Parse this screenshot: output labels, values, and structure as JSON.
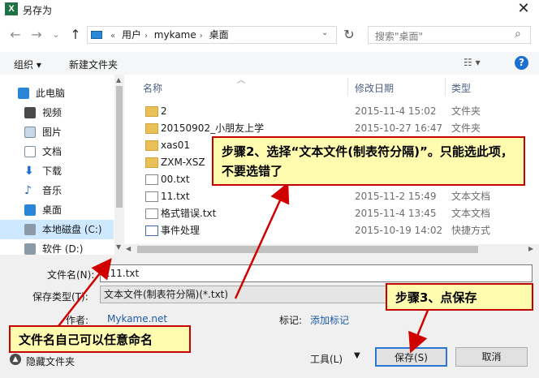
{
  "window": {
    "app_icon": "X",
    "title": "另存为",
    "close": "✕"
  },
  "nav": {
    "back": "←",
    "forward": "→",
    "recent": "⌄",
    "up": "↑",
    "refresh": "↻"
  },
  "address": {
    "overflow": "«",
    "crumbs": [
      "用户",
      "mykame",
      "桌面"
    ]
  },
  "search": {
    "placeholder": "搜索\"桌面\""
  },
  "toolbar": {
    "organize": "组织 ▾",
    "new_folder": "新建文件夹",
    "view": "☷ ▾",
    "help": "?"
  },
  "sidebar": {
    "items": [
      "此电脑",
      "视频",
      "图片",
      "文档",
      "下载",
      "音乐",
      "桌面",
      "本地磁盘 (C:)",
      "软件 (D:)"
    ]
  },
  "columns": {
    "name": "名称",
    "date": "修改日期",
    "type": "类型"
  },
  "files": [
    {
      "name": "2",
      "date": "2015-11-4 15:02",
      "type": "文件夹"
    },
    {
      "name": "20150902_小朋友上学",
      "date": "2015-10-27 16:47",
      "type": "文件夹"
    },
    {
      "name": "xas01",
      "date": "",
      "type": ""
    },
    {
      "name": "ZXM-XSZ",
      "date": "",
      "type": ""
    },
    {
      "name": "00.txt",
      "date": "",
      "type": ""
    },
    {
      "name": "11.txt",
      "date": "2015-11-2 15:49",
      "type": "文本文档"
    },
    {
      "name": "格式错误.txt",
      "date": "2015-11-4 13:45",
      "type": "文本文档"
    },
    {
      "name": "事件处理",
      "date": "2015-10-19 14:02",
      "type": "快捷方式"
    }
  ],
  "form": {
    "filename_label": "文件名(N):",
    "filename_value": "111.txt",
    "savetype_label": "保存类型(T):",
    "savetype_value": "文本文件(制表符分隔)(*.txt)",
    "author_label": "作者:",
    "author_value": "Mykame.net",
    "tags_label": "标记:",
    "tags_value": "添加标记"
  },
  "footer": {
    "hide_folders": "隐藏文件夹",
    "tools": "工具(L)",
    "save": "保存(S)",
    "cancel": "取消"
  },
  "annotations": {
    "step2": "步骤2、选择“文本文件(制表符分隔)”。只能选此项，不要选错了",
    "step3": "步骤3、点保存",
    "filename_tip": "文件名自己可以任意命名"
  }
}
